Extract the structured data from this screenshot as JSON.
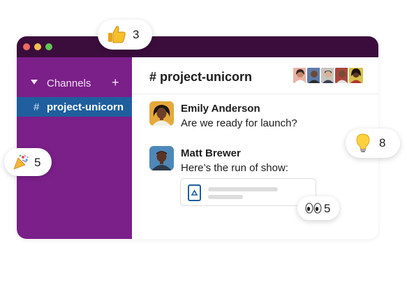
{
  "sidebar": {
    "section_label": "Channels",
    "add_label": "+",
    "active_channel_hash": "#",
    "active_channel_name": "project-unicorn"
  },
  "channel": {
    "title": "# project-unicorn"
  },
  "messages": [
    {
      "author": "Emily Anderson",
      "text": "Are we ready for launch?"
    },
    {
      "author": "Matt Brewer",
      "text": "Here’s the run of show:"
    }
  ],
  "reactions": {
    "thumbs_up": {
      "icon": "thumbs-up-icon",
      "count": "3"
    },
    "party": {
      "icon": "party-popper-icon",
      "count": "5"
    },
    "lightbulb": {
      "icon": "lightbulb-icon",
      "count": "8"
    },
    "eyes": {
      "icon": "eyes-icon",
      "count": "5"
    }
  },
  "colors": {
    "titlebar": "#3b0d3c",
    "sidebar": "#7b1f89",
    "active_channel": "#1f5f9e"
  }
}
